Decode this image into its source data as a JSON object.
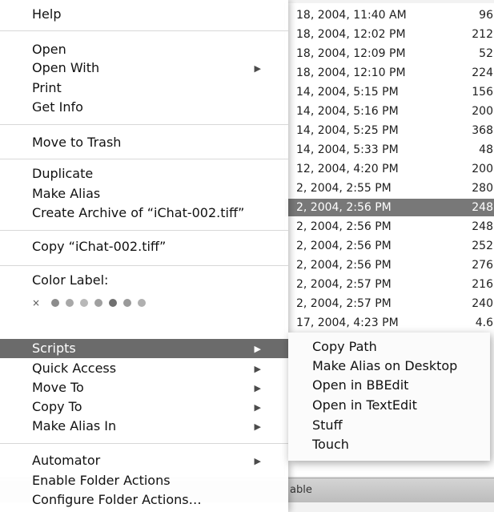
{
  "background_list": {
    "rows": [
      {
        "date": "18, 2004, 11:40 AM",
        "size": "96",
        "selected": false
      },
      {
        "date": "18, 2004, 12:02 PM",
        "size": "212",
        "selected": false
      },
      {
        "date": "18, 2004, 12:09 PM",
        "size": "52",
        "selected": false
      },
      {
        "date": "18, 2004, 12:10 PM",
        "size": "224",
        "selected": false
      },
      {
        "date": "14, 2004, 5:15 PM",
        "size": "156",
        "selected": false
      },
      {
        "date": "14, 2004, 5:16 PM",
        "size": "200",
        "selected": false
      },
      {
        "date": "14, 2004, 5:25 PM",
        "size": "368",
        "selected": false
      },
      {
        "date": "14, 2004, 5:33 PM",
        "size": "48",
        "selected": false
      },
      {
        "date": "12, 2004, 4:20 PM",
        "size": "200",
        "selected": false
      },
      {
        "date": "2, 2004, 2:55 PM",
        "size": "280",
        "selected": false
      },
      {
        "date": "2, 2004, 2:56 PM",
        "size": "248",
        "selected": true
      },
      {
        "date": "2, 2004, 2:56 PM",
        "size": "248",
        "selected": false
      },
      {
        "date": "2, 2004, 2:56 PM",
        "size": "252",
        "selected": false
      },
      {
        "date": "2, 2004, 2:56 PM",
        "size": "276",
        "selected": false
      },
      {
        "date": "2, 2004, 2:57 PM",
        "size": "216",
        "selected": false
      },
      {
        "date": "2, 2004, 2:57 PM",
        "size": "240",
        "selected": false
      },
      {
        "date": "17, 2004, 4:23 PM",
        "size": "4.6",
        "selected": false
      }
    ],
    "status_text": "able"
  },
  "context_menu": {
    "help": "Help",
    "open": "Open",
    "open_with": "Open With",
    "print": "Print",
    "get_info": "Get Info",
    "move_to_trash": "Move to Trash",
    "duplicate": "Duplicate",
    "make_alias": "Make Alias",
    "create_archive": "Create Archive of “iChat-002.tiff”",
    "copy_file": "Copy “iChat-002.tiff”",
    "color_label": "Color Label:",
    "color_label_none": "×",
    "label_colors": [
      "#8c8c8c",
      "#a8a8a8",
      "#b8b8b8",
      "#a0a0a0",
      "#707070",
      "#9a9a9a",
      "#b0b0b0"
    ],
    "scripts": "Scripts",
    "quick_access": "Quick Access",
    "move_to": "Move To",
    "copy_to": "Copy To",
    "make_alias_in": "Make Alias In",
    "automator": "Automator",
    "enable_folder_actions": "Enable Folder Actions",
    "configure_folder_actions": "Configure Folder Actions…",
    "submenu_arrow": "▶"
  },
  "scripts_submenu": {
    "items": [
      "Copy Path",
      "Make Alias on Desktop",
      "Open in BBEdit",
      "Open in TextEdit",
      "Stuff",
      "Touch"
    ]
  }
}
